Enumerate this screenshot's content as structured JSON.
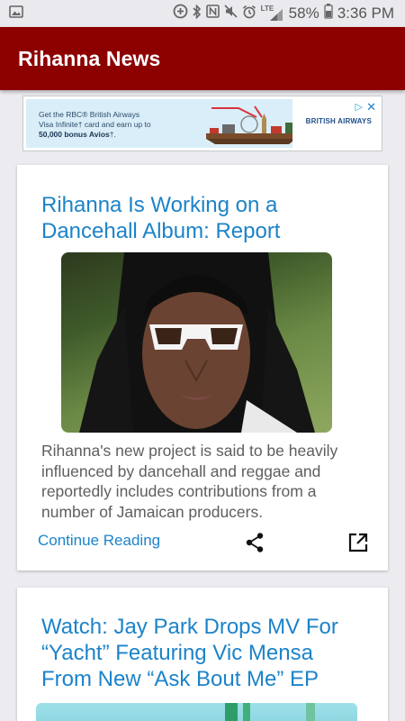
{
  "status_bar": {
    "icons": [
      "image-icon",
      "data-saver-icon",
      "bluetooth-icon",
      "nfc-icon",
      "mute-icon",
      "alarm-icon",
      "lte-signal-icon",
      "battery-icon"
    ],
    "network": "LTE",
    "battery": "58%",
    "time": "3:36 PM"
  },
  "app_bar": {
    "title": "Rihanna News"
  },
  "ad": {
    "line1": "Get the RBC® British Airways",
    "line2": "Visa Infinite† card and earn up to",
    "line3_strong": "50,000 bonus Avios",
    "line3_rest": "†.",
    "brand": "BRITISH AIRWAYS",
    "colors": {
      "background": "#d9eef8",
      "brand": "#1f4e8c"
    }
  },
  "articles": [
    {
      "title": "Rihanna Is Working on a Dancehall Album: Report",
      "summary": "Rihanna's new project is said to be heavily influenced by dancehall and reggae and reportedly includes contributions from a number of Jamaican producers.",
      "continue_label": "Continue Reading"
    },
    {
      "title": "Watch: Jay Park Drops MV For “Yacht” Featuring Vic Mensa From New “Ask Bout Me” EP"
    }
  ],
  "colors": {
    "app_bar": "#8d0000",
    "link": "#1c83c9",
    "body_text": "#5e5e5e",
    "background": "#ececf0"
  }
}
